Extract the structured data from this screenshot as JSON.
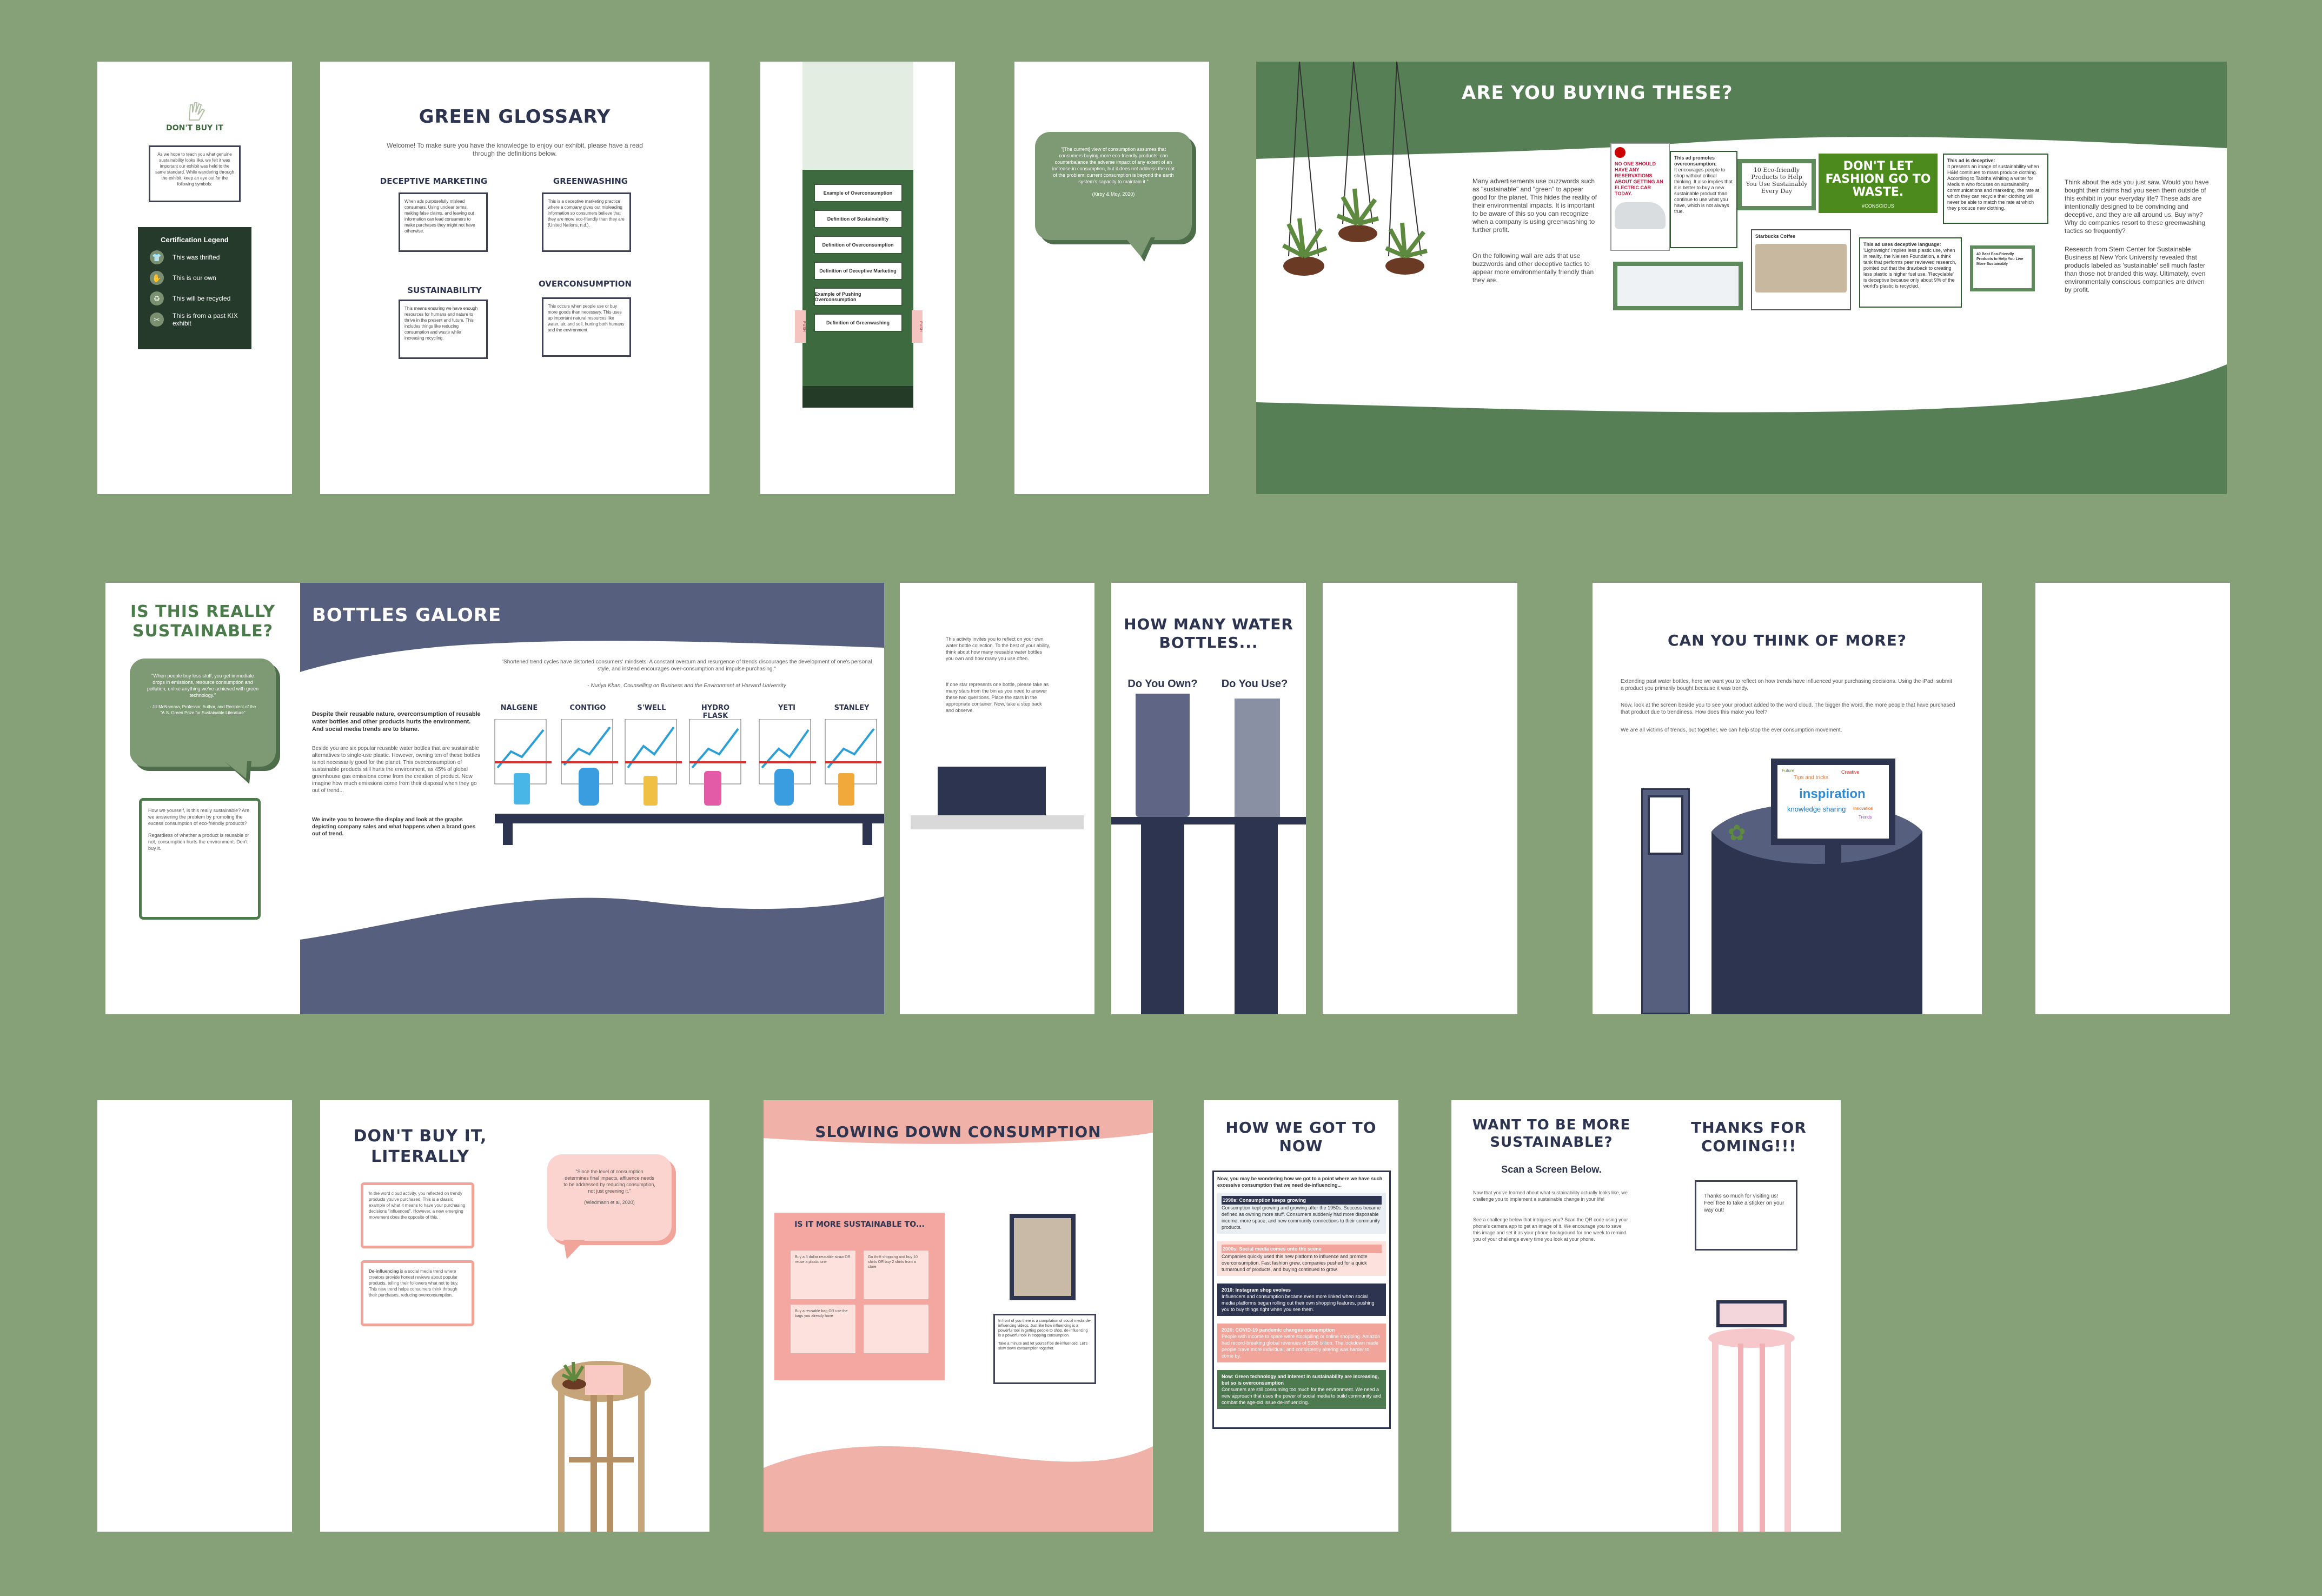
{
  "colors": {
    "background": "#86a077",
    "forest": "#4e7a4f",
    "navy": "#2d3450",
    "slate": "#575f7e",
    "pink": "#f0a49a",
    "cream": "#ffffff"
  },
  "p1": {
    "logo_text": "DON'T BUY IT",
    "intro": "As we hope to teach you what genuine sustainability looks like, we felt it was important our exhibit was held to the same standard. While wandering through the exhibit, keep an eye out for the following symbols:",
    "legend_title": "Certification Legend",
    "legend": [
      {
        "icon": "shirt-icon",
        "glyph": "👕",
        "label": "This was thrifted"
      },
      {
        "icon": "hand-icon",
        "glyph": "✋",
        "label": "This is our own"
      },
      {
        "icon": "recycle-icon",
        "glyph": "♻",
        "label": "This will be recycled"
      },
      {
        "icon": "kit-icon",
        "glyph": "✂",
        "label": "This is from a past KIX exhibit"
      }
    ]
  },
  "p2": {
    "title": "GREEN GLOSSARY",
    "welcome": "Welcome! To make sure you have the knowledge to enjoy our exhibit, please have a read through the definitions below.",
    "terms": [
      {
        "head": "DECEPTIVE MARKETING",
        "def": "When ads purposefully mislead consumers. Using unclear terms, making false claims, and leaving out information can lead consumers to make purchases they might not have otherwise."
      },
      {
        "head": "GREENWASHING",
        "def": "This is a deceptive marketing practice where a company gives out misleading information so consumers believe that they are more eco-friendly than they are (United Nations, n.d.)."
      },
      {
        "head": "SUSTAINABILITY",
        "def": "This means ensuring we have enough resources for humans and nature to thrive in the present and future. This includes things like reducing consumption and waste while increasing recycling."
      },
      {
        "head": "OVERCONSUMPTION",
        "def": "This occurs when people use or buy more goods than necessary. This uses up important natural resources like water, air, and soil, hurting both humans and the environment."
      }
    ]
  },
  "p3": {
    "buttons": [
      "Example of Overconsumption",
      "Definition of Sustainability",
      "Definition of Overconsumption",
      "Definition of Deceptive Marketing",
      "Example of Pushing Overconsumption",
      "Definition of Greenwashing"
    ],
    "side_label": "PUSH"
  },
  "p4": {
    "quote": "\"[The current] view of consumption assumes that consumers buying more eco-friendly products, can counterbalance the adverse impact of any extent of an increase in consumption, but it does not address the root of the problem; current consumption is beyond the earth system's capacity to maintain it.\"",
    "cite": "(Kirby & Moy, 2020)"
  },
  "p5": {
    "title": "ARE YOU BUYING THESE?",
    "left_text_1": "Many advertisements use buzzwords such as \"sustainable\" and \"green\" to appear good for the planet. This hides the reality of their environmental impacts. It is important to be aware of this so you can recognize when a company is using greenwashing to further profit.",
    "left_text_2": "On the following wall are ads that use buzzwords and other deceptive tactics to appear more environmentally friendly than they are.",
    "ad_car": "NO ONE SHOULD HAVE ANY RESERVATIONS ABOUT GETTING AN ELECTRIC CAR TODAY.",
    "note_1_title": "This ad promotes overconsumption:",
    "note_1": "It encourages people to shop without critical thinking. It also implies that it is better to buy a new sustainable product than continue to use what you have, which is not always true.",
    "ad_eco": "10 Eco-friendly Products to Help You Use Sustainably Every Day",
    "ad_fashion": "DON'T LET FASHION GO TO WASTE.",
    "ad_fashion_tag": "#CONSCIOUS",
    "note_2_title": "This ad is deceptive:",
    "note_2": "It presents an image of sustainability when H&M continues to mass produce clothing. According to Tabitha Whiting a writer for Medium who focuses on sustainability communications and marketing, the rate at which they can recycle their clothing will never be able to match the rate at which they produce new clothing.",
    "note_3_title": "This ad uses deceptive language:",
    "note_3": "'Lightweight' implies less plastic use, when in reality, the Nielsen Foundation, a think tank that performs peer reviewed research, pointed out that the drawback to creating less plastic is higher fuel use. 'Recyclable' is deceptive because only about 9% of the world's plastic is recycled.",
    "ad_tweet": "Starbucks Coffee",
    "ad_list": "40 Best Eco-Friendly Products to Help You Live More Sustainably",
    "right_text_1": "Think about the ads you just saw. Would you have bought their claims had you seen them outside of this exhibit in your everyday life? These ads are intentionally designed to be convincing and deceptive, and they are all around us. Buy why? Why do companies resort to these greenwashing tactics so frequently?",
    "right_text_2": "Research from Stern Center for Sustainable Business at New York University revealed that products labeled as 'sustainable' sell much faster than those not branded this way. Ultimately, even environmentally conscious companies are driven by profit."
  },
  "p6": {
    "title": "IS THIS REALLY SUSTAINABLE?",
    "quote": "\"When people buy less stuff, you get immediate drops in emissions, resource consumption and pollution, unlike anything we've achieved with green technology.\"",
    "cite": "- Jill McNamara, Professor, Author, and Recipient of the \"A.S. Green Prize for Sustainable Literature\"",
    "box_1": "How we yourself, is this really sustainable? Are we answering the problem by promoting the excess consumption of eco-friendly products?",
    "box_2": "Regardless of whether a product is reusable or not, consumption hurts the environment. Don't buy it."
  },
  "p7": {
    "title": "BOTTLES GALORE",
    "quote": "\"Shortened trend cycles have distorted consumers' mindsets. A constant overturn and resurgence of trends discourages the development of one's personal style, and instead encourages over-consumption and impulse purchasing.\"",
    "cite": "- Nuriya Khan, Counselling on Business and the Environment at Harvard University",
    "para_1": "Despite their reusable nature, overconsumption of reusable water bottles and other products hurts the environment. And social media trends are to blame.",
    "para_2": "Beside you are six popular reusable water bottles that are sustainable alternatives to single-use plastic. However, owning ten of these bottles is not necessarily good for the planet. This overconsumption of sustainable products still hurts the environment, as 45% of global greenhouse gas emissions come from the creation of product. Now imagine how much emissions come from their disposal when they go out of trend...",
    "para_3": "We invite you to browse the display and look at the graphs depicting company sales and what happens when a brand goes out of trend.",
    "brands": [
      "NALGENE",
      "CONTIGO",
      "S'WELL",
      "HYDRO FLASK",
      "YETI",
      "STANLEY"
    ]
  },
  "p8": {
    "text_1": "This activity invites you to reflect on your own water bottle collection. To the best of your ability, think about how many reusable water bottles you own and how many you use often.",
    "text_2": "If one star represents one bottle, please take as many stars from the bin as you need to answer these two questions. Place the stars in the appropriate container. Now, take a step back and observe."
  },
  "p9": {
    "title": "HOW MANY WATER BOTTLES...",
    "own": "Do You Own?",
    "use": "Do You Use?"
  },
  "p11": {
    "title": "CAN YOU THINK OF MORE?",
    "text_1": "Extending past water bottles, here we want you to reflect on how trends have influenced your purchasing decisions. Using the iPad, submit a product you primarily bought because it was trendy.",
    "text_2": "Now, look at the screen beside you to see your product added to the word cloud. The bigger the word, the more people that have purchased that product due to trendiness. How does this make you feel?",
    "text_3": "We are all victims of trends, but together, we can help stop the ever consumption movement.",
    "cloud_big": "inspiration",
    "cloud_words": [
      "Tips and tricks",
      "knowledge sharing",
      "Creative",
      "Future",
      "Trends",
      "Innovation"
    ]
  },
  "p13": {
    "title": "DON'T BUY IT, LITERALLY",
    "box_1": "In the word cloud activity, you reflected on trendy products you've purchased. This is a classic example of what it means to have your purchasing decisions \"influenced\". However, a new emerging movement does the opposite of this.",
    "box_2_head": "De-influencing",
    "box_2": " is a social media trend where creators provide honest reviews about popular products, telling their followers what not to buy. This new trend helps consumers think through their purchases, reducing overconsumption.",
    "quote": "\"Since the level of consumption determines final impacts, affluence needs to be addressed by reducing consumption, not just greening it.\"",
    "cite": "(Wiedmann et al, 2020)"
  },
  "p14": {
    "title": "SLOWING DOWN CONSUMPTION",
    "board_title": "IS IT MORE SUSTAINABLE TO...",
    "card_1": "Buy a 5 dollar reusable straw OR reuse a plastic one",
    "card_2": "Go thrift shopping and buy 10 shirts OR buy 2 shirts from a store",
    "card_3": "Buy a reusable bag OR use the bags you already have",
    "caption": "In front of you there is a compilation of social media de-influencing videos. Just like how influencing is a powerful tool in getting people to shop, de-influencing is a powerful tool in stopping consumption.",
    "caption_2": "Take a minute and let yourself be de-influenced. Let's slow down consumption together."
  },
  "p15": {
    "title": "HOW WE GOT TO NOW",
    "intro": "Now, you may be wondering how we got to a point where we have such excessive consumption that we need de-influencing...",
    "items": [
      {
        "head": "1990s: Consumption keeps growing",
        "body": "Consumption kept growing and growing after the 1950s. Success became defined as owning more stuff. Consumers suddenly had more disposable income, more space, and new community connections to their community products."
      },
      {
        "head": "2000s: Social media comes onto the scene",
        "body": "Companies quickly used this new platform to influence and promote overconsumption. Fast fashion grew, companies pushed for a quick turnaround of products, and buying continued to grow."
      },
      {
        "head": "2010: Instagram shop evolves",
        "body": "Influencers and consumption became even more linked when social media platforms began rolling out their own shopping features, pushing you to buy things right when you see them."
      },
      {
        "head": "2020: COVID-19 pandemic changes consumption",
        "body": "People with income to spare were stockpiling or online shopping. Amazon had record-breaking global revenues of $386 billion. The lockdown made people crave more individual, and consistently altering was harder to come by."
      },
      {
        "head": "Now: Green technology and interest in sustainability are increasing, but so is overconsumption",
        "body": "Consumers are still consuming too much for the environment. We need a new approach that uses the power of social media to build community and combat the age-old issue de-influencing."
      }
    ]
  },
  "p16": {
    "title": "WANT TO BE MORE SUSTAINABLE?",
    "subtitle": "Scan a Screen Below.",
    "text_1": "Now that you've learned about what sustainability actually looks like, we challenge you to implement a sustainable change in your life!",
    "text_2": "See a challenge below that intrigues you? Scan the QR code using your phone's camera app to get an image of it. We encourage you to save this image and set it as your phone background for one week to remind you of your challenge every time you look at your phone.",
    "thanks_title": "THANKS FOR COMING!!!",
    "thanks_text": "Thanks so much for visiting us! Feel free to take a sticker on your way out!"
  }
}
